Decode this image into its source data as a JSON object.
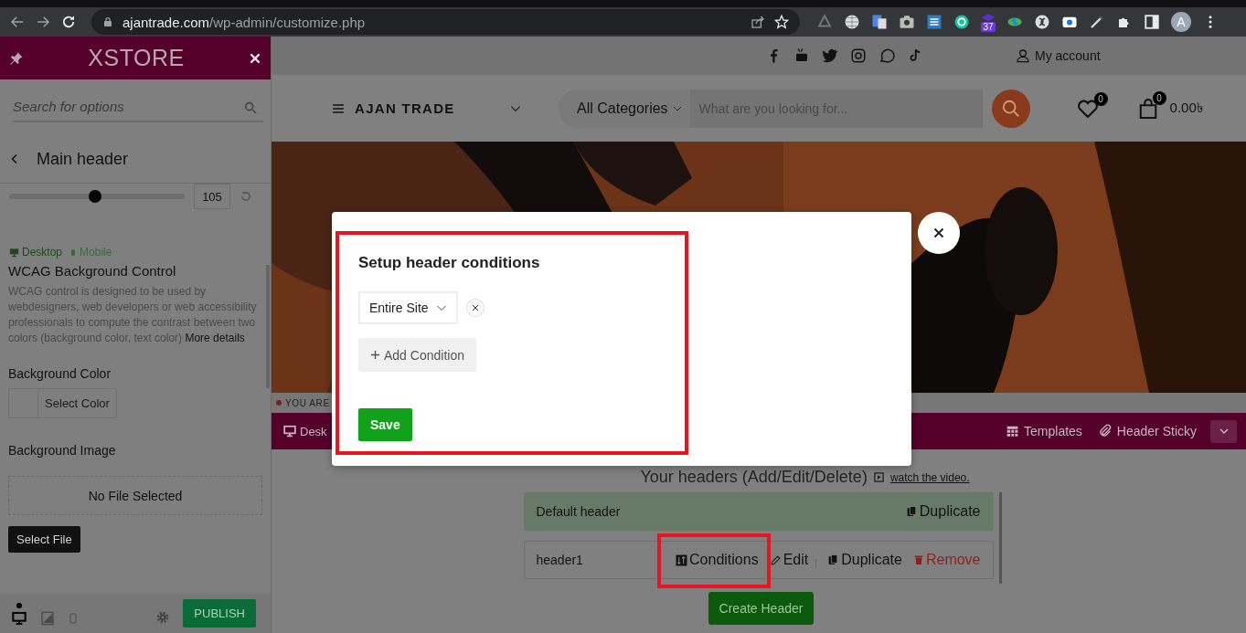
{
  "browser": {
    "url_host": "ajantrade.com",
    "url_path": "/wp-admin/customize.php",
    "extension_badge": "37",
    "profile_initial": "A"
  },
  "sidebar": {
    "logo": "XSTORE",
    "search": {
      "placeholder": "Search for options"
    },
    "section_title": "Main header",
    "slider": {
      "level": 0.49,
      "value": "105"
    },
    "devices": [
      {
        "label": "Desktop",
        "selected": true
      },
      {
        "label": "Mobile",
        "selected": false
      }
    ],
    "control_title": "WCAG Background Control",
    "description": "WCAG control is designed to be used by webdesigners, web developers or web accessibility professionals to compute the contrast between two colors (background color, text color)",
    "more_link": "More details",
    "background_color": {
      "label": "Background Color",
      "button": "Select Color"
    },
    "background_image": {
      "label": "Background Image",
      "empty": "No File Selected",
      "button": "Select File"
    },
    "preview_devices": [
      {
        "kind": "desktop",
        "selected": true
      },
      {
        "kind": "tablet",
        "selected": false
      },
      {
        "kind": "mobile",
        "selected": false
      }
    ],
    "publish": "PUBLISH"
  },
  "site": {
    "account": "My account",
    "logo": "AJAN TRADE",
    "categories": "All Categories",
    "search": {
      "placeholder": "What are you looking for..."
    },
    "wishlist_count": "0",
    "cart_count": "0",
    "cart_total": "0.00৳",
    "notice": "YOU ARE"
  },
  "builder": {
    "tab": "Desk",
    "actions": [
      {
        "kind": "templates",
        "label": "Templates"
      },
      {
        "kind": "sticky",
        "label": "Header Sticky"
      }
    ],
    "heading": "Your headers (Add/Edit/Delete)",
    "video_link": "watch the video.",
    "headers": [
      {
        "name": "Default header",
        "default": true,
        "actions": [
          {
            "kind": "duplicate",
            "label": "Duplicate",
            "highlighted": false
          }
        ]
      },
      {
        "name": "header1",
        "default": false,
        "actions": [
          {
            "kind": "conditions",
            "label": "Conditions",
            "highlighted": true
          },
          {
            "kind": "edit",
            "label": "Edit",
            "highlighted": false
          },
          {
            "kind": "duplicate",
            "label": "Duplicate",
            "highlighted": false
          },
          {
            "kind": "remove",
            "label": "Remove",
            "highlighted": false
          }
        ]
      }
    ],
    "create": "Create Header"
  },
  "modal": {
    "title": "Setup header conditions",
    "highlighted": true,
    "conditions": [
      {
        "value": "Entire Site"
      }
    ],
    "add": "Add Condition",
    "save": "Save"
  }
}
